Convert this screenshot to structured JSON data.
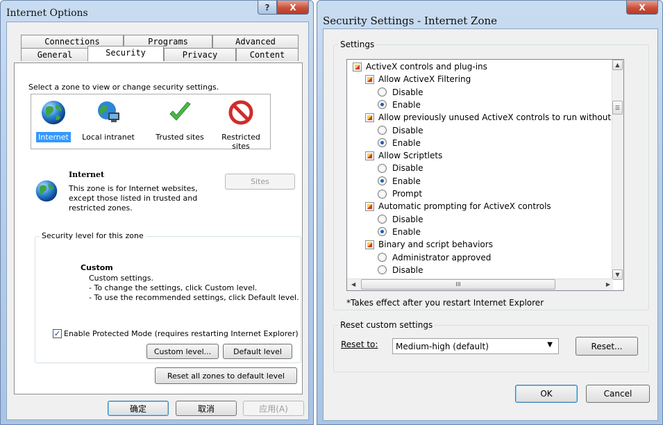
{
  "internet_options": {
    "title": "Internet Options",
    "help_symbol": "?",
    "close_symbol": "X",
    "tabs": {
      "connections": "Connections",
      "programs": "Programs",
      "advanced": "Advanced",
      "general": "General",
      "security": "Security",
      "privacy": "Privacy",
      "content": "Content"
    },
    "select_zone_text": "Select a zone to view or change security settings.",
    "zones": [
      {
        "label": "Internet",
        "icon": "globe-icon"
      },
      {
        "label": "Local intranet",
        "icon": "intranet-icon"
      },
      {
        "label": "Trusted sites",
        "icon": "checkmark-icon"
      },
      {
        "label": "Restricted sites",
        "icon": "prohibited-icon"
      }
    ],
    "zone_info": {
      "name": "Internet",
      "description": "This zone is for Internet websites, except those listed in trusted and restricted zones."
    },
    "sites_button": "Sites",
    "security_level_label": "Security level for this zone",
    "level": {
      "name": "Custom",
      "line1": "Custom settings.",
      "line2": "- To change the settings, click Custom level.",
      "line3": "- To use the recommended settings, click Default level."
    },
    "protected_mode": {
      "checked": true,
      "label": "Enable Protected Mode (requires restarting Internet Explorer)"
    },
    "custom_level_button": "Custom level...",
    "default_level_button": "Default level",
    "reset_all_button": "Reset all zones to default level",
    "ok_button": "确定",
    "cancel_button": "取消",
    "apply_button": "应用(A)"
  },
  "security_settings": {
    "title": "Security Settings - Internet Zone",
    "close_symbol": "X",
    "settings_label": "Settings",
    "items": [
      {
        "kind": "category",
        "text": "ActiveX controls and plug-ins"
      },
      {
        "kind": "setting",
        "text": "Allow ActiveX Filtering"
      },
      {
        "kind": "option",
        "text": "Disable",
        "selected": false
      },
      {
        "kind": "option",
        "text": "Enable",
        "selected": true
      },
      {
        "kind": "setting",
        "text": "Allow previously unused ActiveX controls to run without prom"
      },
      {
        "kind": "option",
        "text": "Disable",
        "selected": false
      },
      {
        "kind": "option",
        "text": "Enable",
        "selected": true
      },
      {
        "kind": "setting",
        "text": "Allow Scriptlets"
      },
      {
        "kind": "option",
        "text": "Disable",
        "selected": false
      },
      {
        "kind": "option",
        "text": "Enable",
        "selected": true
      },
      {
        "kind": "option",
        "text": "Prompt",
        "selected": false
      },
      {
        "kind": "setting",
        "text": "Automatic prompting for ActiveX controls"
      },
      {
        "kind": "option",
        "text": "Disable",
        "selected": false
      },
      {
        "kind": "option",
        "text": "Enable",
        "selected": true
      },
      {
        "kind": "setting",
        "text": "Binary and script behaviors"
      },
      {
        "kind": "option",
        "text": "Administrator approved",
        "selected": false
      },
      {
        "kind": "option",
        "text": "Disable",
        "selected": false
      }
    ],
    "scroll_thumb_glyph": "☰",
    "hscroll_thumb_glyph": "III",
    "footnote": "*Takes effect after you restart Internet Explorer",
    "reset_group_label": "Reset custom settings",
    "reset_to_label": "Reset to:",
    "reset_to_value": "Medium-high (default)",
    "reset_button": "Reset...",
    "ok_button": "OK",
    "cancel_button": "Cancel"
  },
  "colors": {
    "selection": "#3399ff",
    "title_bar": "#b7cfea",
    "close_button": "#c9503b"
  }
}
